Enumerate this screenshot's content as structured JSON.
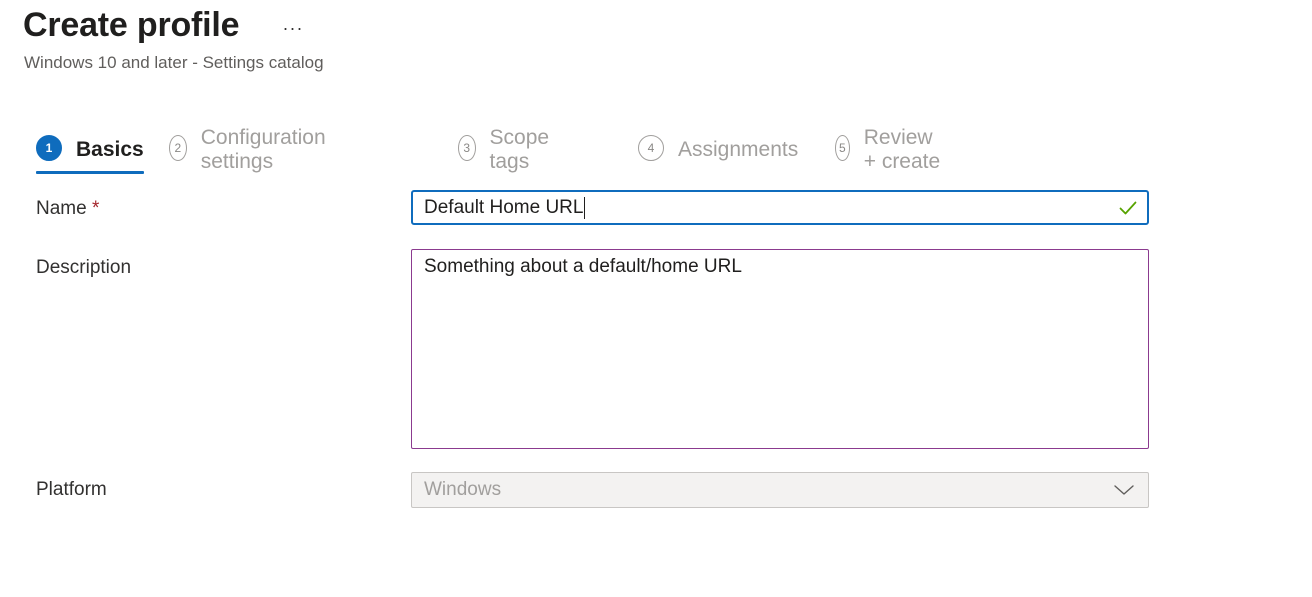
{
  "header": {
    "title": "Create profile",
    "more_label": "···",
    "subtitle": "Windows 10 and later - Settings catalog"
  },
  "steps": [
    {
      "number": "1",
      "label": "Basics",
      "active": true
    },
    {
      "number": "2",
      "label": "Configuration settings",
      "active": false
    },
    {
      "number": "3",
      "label": "Scope tags",
      "active": false
    },
    {
      "number": "4",
      "label": "Assignments",
      "active": false
    },
    {
      "number": "5",
      "label": "Review + create",
      "active": false
    }
  ],
  "form": {
    "name": {
      "label": "Name",
      "required_marker": "*",
      "value": "Default Home URL",
      "status_icon": "checkmark-icon"
    },
    "description": {
      "label": "Description",
      "value": "Something about a default/home URL"
    },
    "platform": {
      "label": "Platform",
      "value": "Windows",
      "icon": "chevron-down-icon"
    }
  },
  "colors": {
    "accent": "#0f6cbd",
    "required": "#a4262c",
    "valid_check": "#57a300",
    "description_border": "#8b3a8f"
  }
}
